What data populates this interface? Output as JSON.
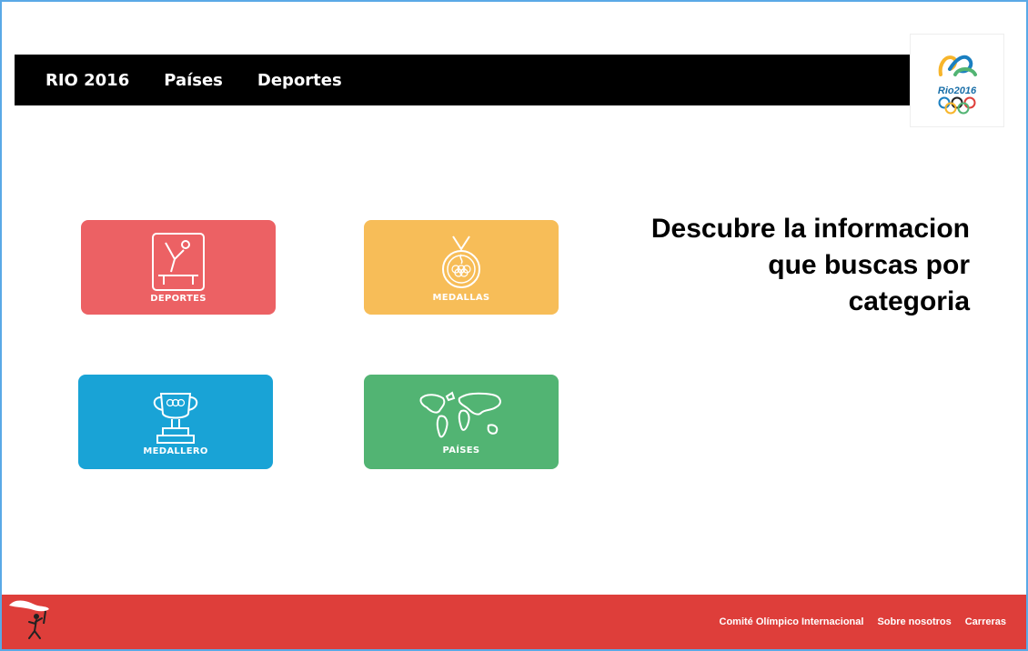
{
  "nav": {
    "links": [
      {
        "label": "RIO 2016"
      },
      {
        "label": "Países"
      },
      {
        "label": "Deportes"
      }
    ]
  },
  "logo": {
    "text": "Rio2016"
  },
  "cards": [
    {
      "label": "DEPORTES",
      "color": "#ec6164",
      "icon": "gymnastics-icon"
    },
    {
      "label": "MEDALLAS",
      "color": "#f7bd58",
      "icon": "medal-icon"
    },
    {
      "label": "MEDALLERO",
      "color": "#19a3d6",
      "icon": "trophy-icon"
    },
    {
      "label": "PAÍSES",
      "color": "#52b473",
      "icon": "world-map-icon"
    }
  ],
  "headline": {
    "line1": "Descubre la informacion",
    "line2": "que buscas por",
    "line3": "categoria"
  },
  "footer": {
    "links": [
      {
        "label": "Comité Olímpico Internacional"
      },
      {
        "label": "Sobre nosotros"
      },
      {
        "label": "Carreras"
      }
    ],
    "color": "#de3e3a"
  }
}
